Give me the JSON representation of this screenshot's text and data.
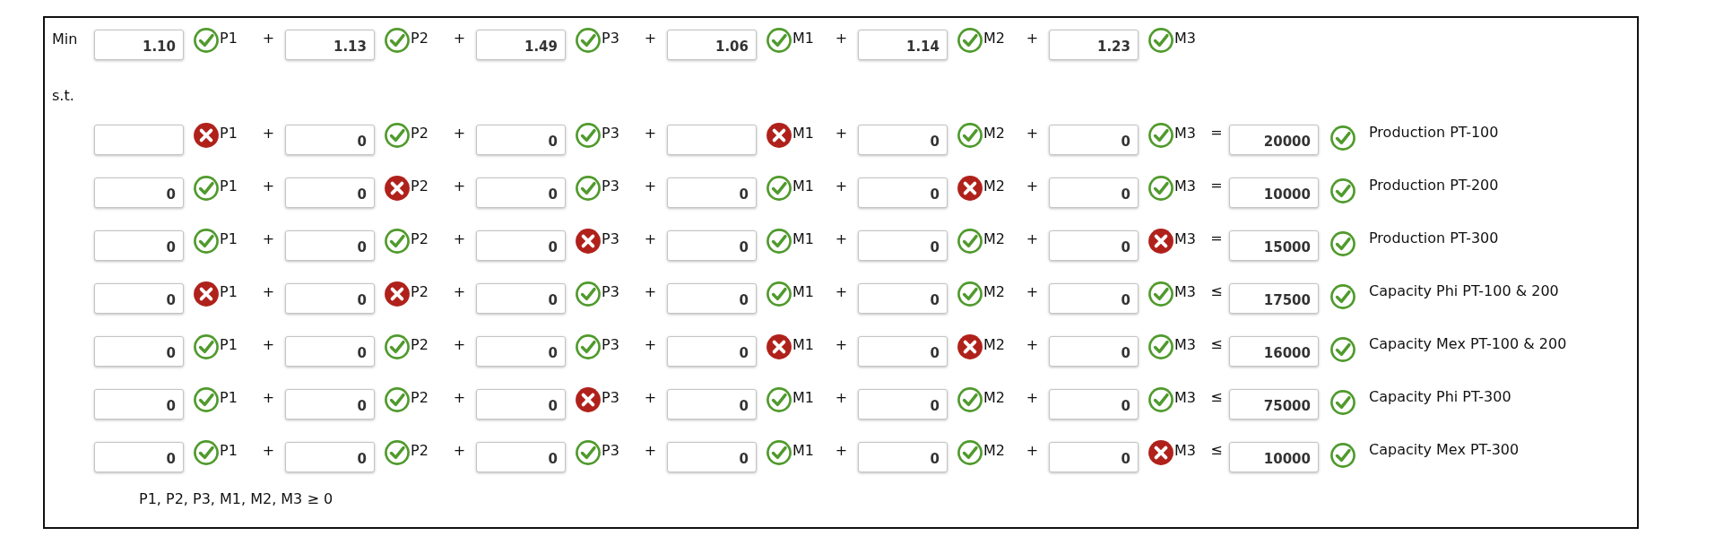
{
  "objective": {
    "label": "Min",
    "terms": [
      {
        "value": "1.10",
        "ok": true,
        "variable": "P1",
        "sign": "+"
      },
      {
        "value": "1.13",
        "ok": true,
        "variable": "P2",
        "sign": "+"
      },
      {
        "value": "1.49",
        "ok": true,
        "variable": "P3",
        "sign": "+"
      },
      {
        "value": "1.06",
        "ok": true,
        "variable": "M1",
        "sign": "+"
      },
      {
        "value": "1.14",
        "ok": true,
        "variable": "M2",
        "sign": "+"
      },
      {
        "value": "1.23",
        "ok": true,
        "variable": "M3"
      }
    ]
  },
  "subject_to_label": "s.t.",
  "constraints": [
    {
      "terms": [
        {
          "ok": false,
          "variable": "P1",
          "sign": "+"
        },
        {
          "value": "0",
          "ok": true,
          "variable": "P2",
          "sign": "+"
        },
        {
          "value": "0",
          "ok": true,
          "variable": "P3",
          "sign": "+"
        },
        {
          "ok": false,
          "variable": "M1",
          "sign": "+"
        },
        {
          "value": "0",
          "ok": true,
          "variable": "M2",
          "sign": "+"
        },
        {
          "value": "0",
          "ok": true,
          "variable": "M3"
        }
      ],
      "relation": "=",
      "rhs": "20000",
      "rhs_ok": true,
      "name": "Production PT-100"
    },
    {
      "terms": [
        {
          "value": "0",
          "ok": true,
          "variable": "P1",
          "sign": "+"
        },
        {
          "value": "0",
          "ok": false,
          "variable": "P2",
          "sign": "+"
        },
        {
          "value": "0",
          "ok": true,
          "variable": "P3",
          "sign": "+"
        },
        {
          "value": "0",
          "ok": true,
          "variable": "M1",
          "sign": "+"
        },
        {
          "value": "0",
          "ok": false,
          "variable": "M2",
          "sign": "+"
        },
        {
          "value": "0",
          "ok": true,
          "variable": "M3"
        }
      ],
      "relation": "=",
      "rhs": "10000",
      "rhs_ok": true,
      "name": "Production PT-200"
    },
    {
      "terms": [
        {
          "value": "0",
          "ok": true,
          "variable": "P1",
          "sign": "+"
        },
        {
          "value": "0",
          "ok": true,
          "variable": "P2",
          "sign": "+"
        },
        {
          "value": "0",
          "ok": false,
          "variable": "P3",
          "sign": "+"
        },
        {
          "value": "0",
          "ok": true,
          "variable": "M1",
          "sign": "+"
        },
        {
          "value": "0",
          "ok": true,
          "variable": "M2",
          "sign": "+"
        },
        {
          "value": "0",
          "ok": false,
          "variable": "M3"
        }
      ],
      "relation": "=",
      "rhs": "15000",
      "rhs_ok": true,
      "name": "Production PT-300"
    },
    {
      "terms": [
        {
          "value": "0",
          "ok": false,
          "variable": "P1",
          "sign": "+"
        },
        {
          "value": "0",
          "ok": false,
          "variable": "P2",
          "sign": "+"
        },
        {
          "value": "0",
          "ok": true,
          "variable": "P3",
          "sign": "+"
        },
        {
          "value": "0",
          "ok": true,
          "variable": "M1",
          "sign": "+"
        },
        {
          "value": "0",
          "ok": true,
          "variable": "M2",
          "sign": "+"
        },
        {
          "value": "0",
          "ok": true,
          "variable": "M3"
        }
      ],
      "relation": "≤",
      "rhs": "17500",
      "rhs_ok": true,
      "name": "Capacity Phi PT-100 & 200"
    },
    {
      "terms": [
        {
          "value": "0",
          "ok": true,
          "variable": "P1",
          "sign": "+"
        },
        {
          "value": "0",
          "ok": true,
          "variable": "P2",
          "sign": "+"
        },
        {
          "value": "0",
          "ok": true,
          "variable": "P3",
          "sign": "+"
        },
        {
          "value": "0",
          "ok": false,
          "variable": "M1",
          "sign": "+"
        },
        {
          "value": "0",
          "ok": false,
          "variable": "M2",
          "sign": "+"
        },
        {
          "value": "0",
          "ok": true,
          "variable": "M3"
        }
      ],
      "relation": "≤",
      "rhs": "16000",
      "rhs_ok": true,
      "name": "Capacity Mex PT-100 & 200"
    },
    {
      "terms": [
        {
          "value": "0",
          "ok": true,
          "variable": "P1",
          "sign": "+"
        },
        {
          "value": "0",
          "ok": true,
          "variable": "P2",
          "sign": "+"
        },
        {
          "value": "0",
          "ok": false,
          "variable": "P3",
          "sign": "+"
        },
        {
          "value": "0",
          "ok": true,
          "variable": "M1",
          "sign": "+"
        },
        {
          "value": "0",
          "ok": true,
          "variable": "M2",
          "sign": "+"
        },
        {
          "value": "0",
          "ok": true,
          "variable": "M3"
        }
      ],
      "relation": "≤",
      "rhs": "75000",
      "rhs_ok": true,
      "name": "Capacity Phi PT-300"
    },
    {
      "terms": [
        {
          "value": "0",
          "ok": true,
          "variable": "P1",
          "sign": "+"
        },
        {
          "value": "0",
          "ok": true,
          "variable": "P2",
          "sign": "+"
        },
        {
          "value": "0",
          "ok": true,
          "variable": "P3",
          "sign": "+"
        },
        {
          "value": "0",
          "ok": true,
          "variable": "M1",
          "sign": "+"
        },
        {
          "value": "0",
          "ok": true,
          "variable": "M2",
          "sign": "+"
        },
        {
          "value": "0",
          "ok": false,
          "variable": "M3"
        }
      ],
      "relation": "≤",
      "rhs": "10000",
      "rhs_ok": true,
      "name": "Capacity Mex PT-300"
    }
  ],
  "nonnegativity": "P1, P2, P3, M1, M2, M3 ≥ 0"
}
